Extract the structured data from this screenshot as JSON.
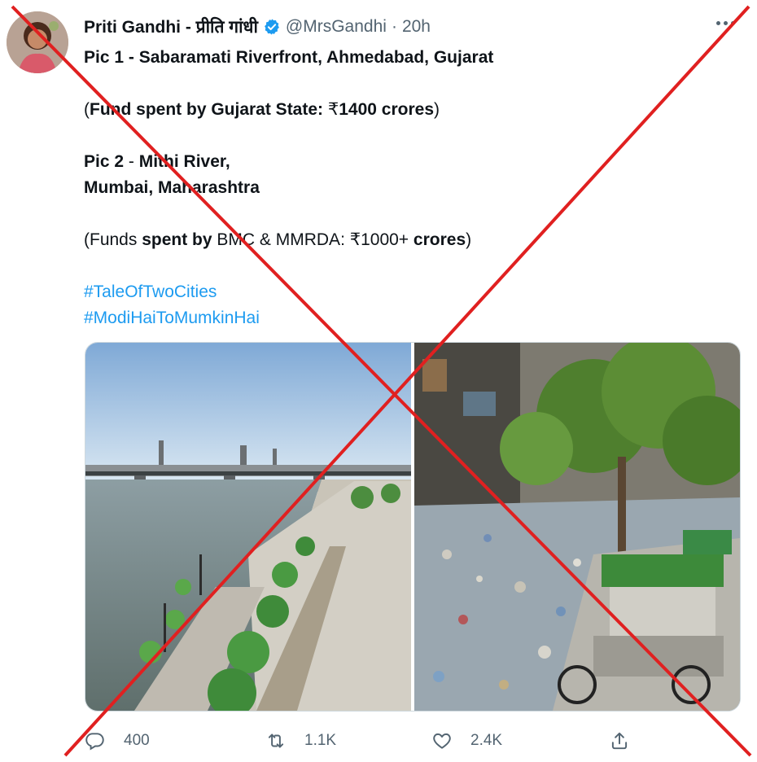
{
  "tweet": {
    "author_name": "Priti Gandhi - प्रीति गांधी",
    "handle": "@MrsGandhi",
    "separator": "·",
    "time": "20h",
    "lines": {
      "l1": "Pic 1 - Sabaramati Riverfront, Ahmedabad, Gujarat",
      "l2_open": "(",
      "l2_bold": "Fund spent by Gujarat State:",
      "l2_amount_prefix": " ₹",
      "l2_amount_bold": "1400 crores",
      "l2_close": ")",
      "l3_bold": "Pic 2",
      "l3_rest": " - ",
      "l3_bold2": "Mithi River,",
      "l4_bold": "Mumbai, Maharashtra",
      "l5_open": "(Funds ",
      "l5_bold": "spent by",
      "l5_mid": " BMC & MMRDA: ₹1000+ ",
      "l5_bold2": "crores",
      "l5_close": ")"
    },
    "hashtags": [
      "#TaleOfTwoCities",
      "#ModiHaiToMumkinHai"
    ]
  },
  "actions": {
    "replies": "400",
    "retweets": "1.1K",
    "likes": "2.4K"
  },
  "icons": {
    "verified": "verified-badge-icon",
    "more": "more-icon",
    "reply": "reply-icon",
    "retweet": "retweet-icon",
    "like": "heart-icon",
    "share": "share-icon"
  },
  "colors": {
    "accent": "#1d9bf0",
    "muted": "#536471",
    "cross": "#e02020"
  }
}
